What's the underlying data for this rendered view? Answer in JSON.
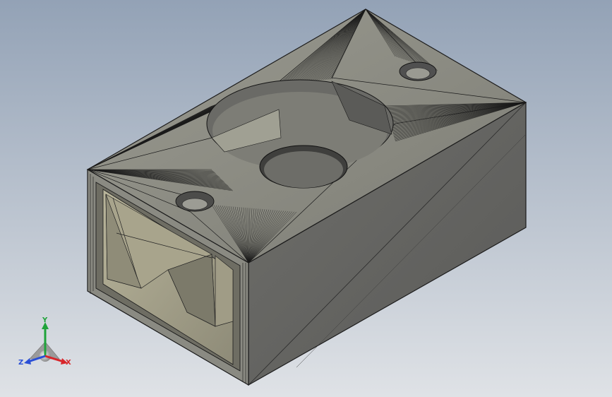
{
  "viewport": {
    "background_top": "#93a2b6",
    "background_bottom": "#dfe2e6"
  },
  "model": {
    "face_top": "#8a8a80",
    "face_front": "#5f5f5c",
    "face_side": "#6f6f6a",
    "edge": "#1c1c1c"
  },
  "triad": {
    "x_label": "X",
    "y_label": "Y",
    "z_label": "Z",
    "x_color": "#d8262b",
    "y_color": "#1fa33a",
    "z_color": "#2a4fd6"
  }
}
